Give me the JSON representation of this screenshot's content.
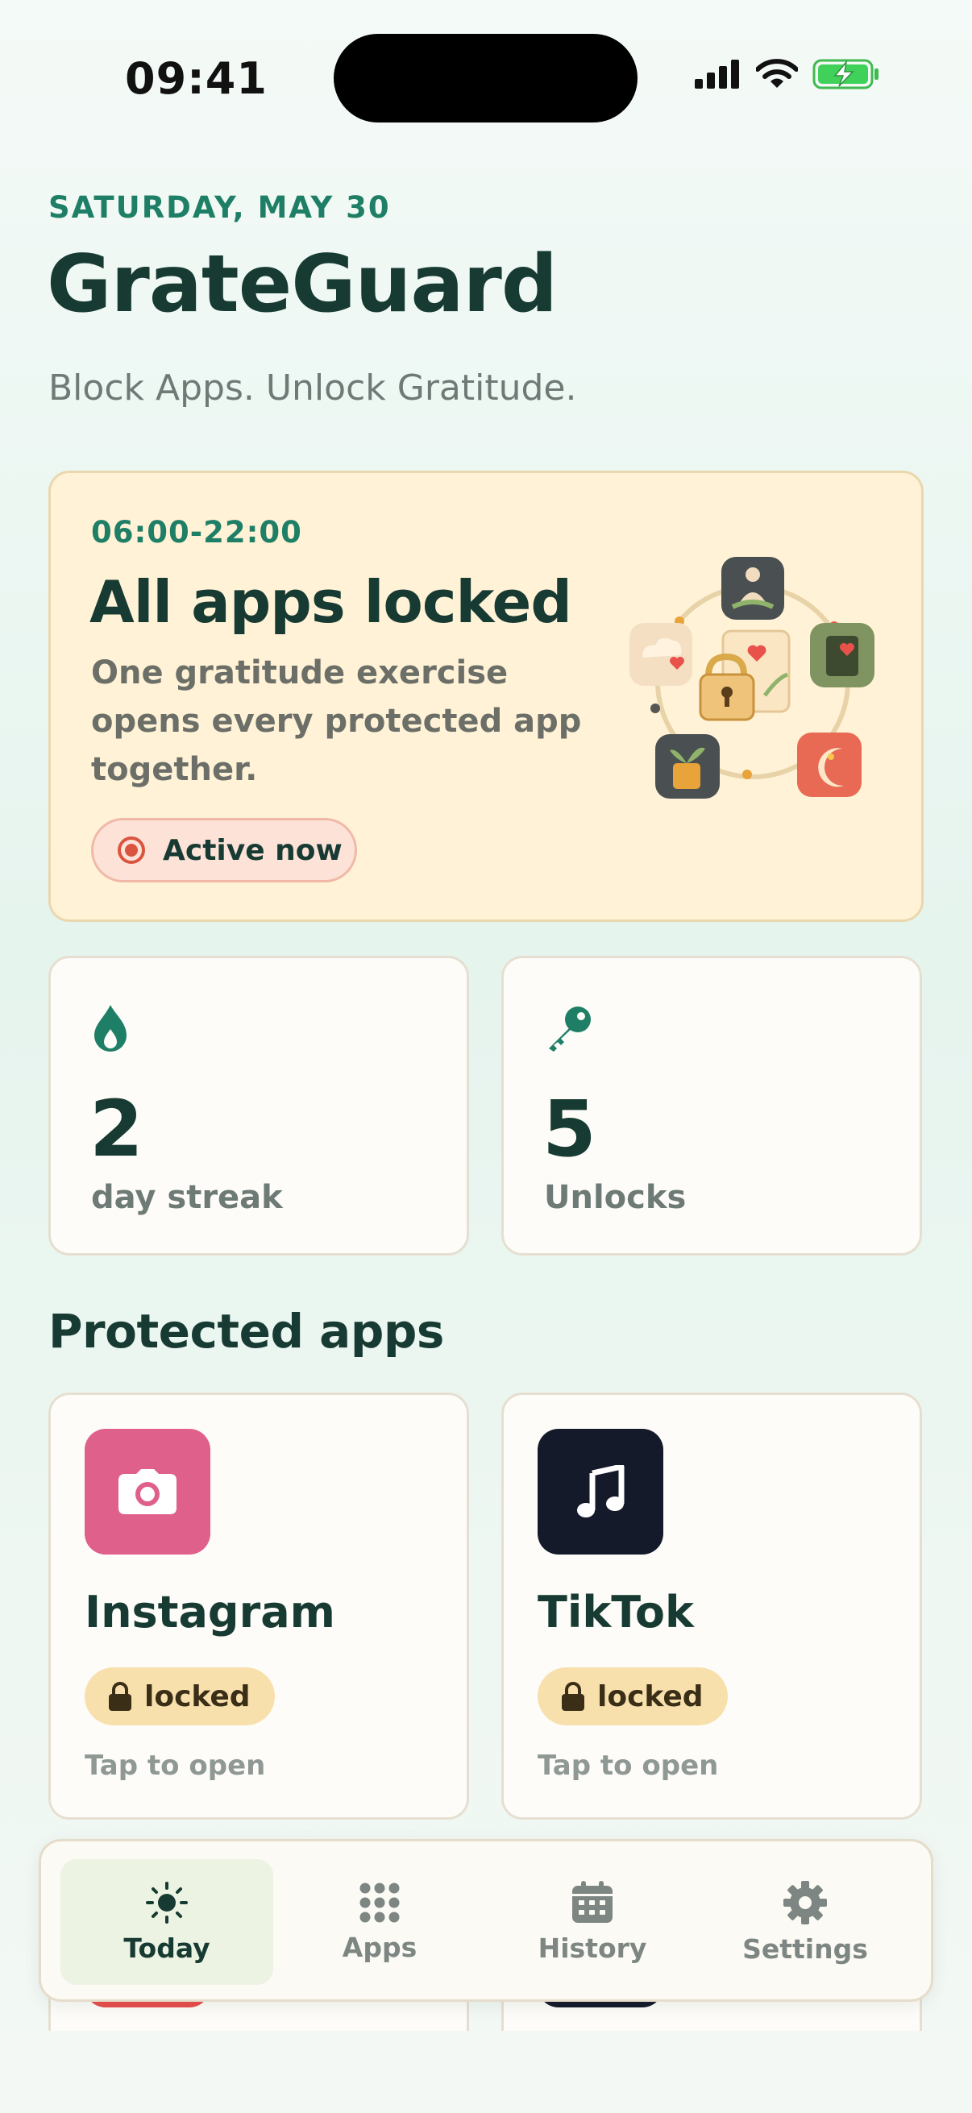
{
  "status_bar": {
    "time": "09:41"
  },
  "header": {
    "date": "SATURDAY, MAY 30",
    "title": "GrateGuard",
    "tagline": "Block Apps. Unlock Gratitude."
  },
  "schedule_card": {
    "time_range": "06:00-22:00",
    "title": "All apps locked",
    "description": "One gratitude exercise opens every protected app together.",
    "status_label": "Active now"
  },
  "stats": [
    {
      "icon": "flame-icon",
      "value": "2",
      "label": "day streak"
    },
    {
      "icon": "key-icon",
      "value": "5",
      "label": "Unlocks"
    }
  ],
  "protected_apps": {
    "title": "Protected apps",
    "items": [
      {
        "name": "Instagram",
        "icon": "camera-icon",
        "color": "#e0608c",
        "status": "locked",
        "action": "Tap to open"
      },
      {
        "name": "TikTok",
        "icon": "music-note-icon",
        "color": "#151a2b",
        "status": "locked",
        "action": "Tap to open"
      }
    ]
  },
  "tab_bar": {
    "tabs": [
      {
        "label": "Today",
        "icon": "sun-icon",
        "active": true
      },
      {
        "label": "Apps",
        "icon": "grid-icon",
        "active": false
      },
      {
        "label": "History",
        "icon": "calendar-icon",
        "active": false
      },
      {
        "label": "Settings",
        "icon": "gear-icon",
        "active": false
      }
    ]
  },
  "colors": {
    "accent": "#1f7f66",
    "heading": "#173b32",
    "hero_background": "#fff2d6",
    "active_red": "#d9553f",
    "locked_badge": "#f8e0ad"
  }
}
